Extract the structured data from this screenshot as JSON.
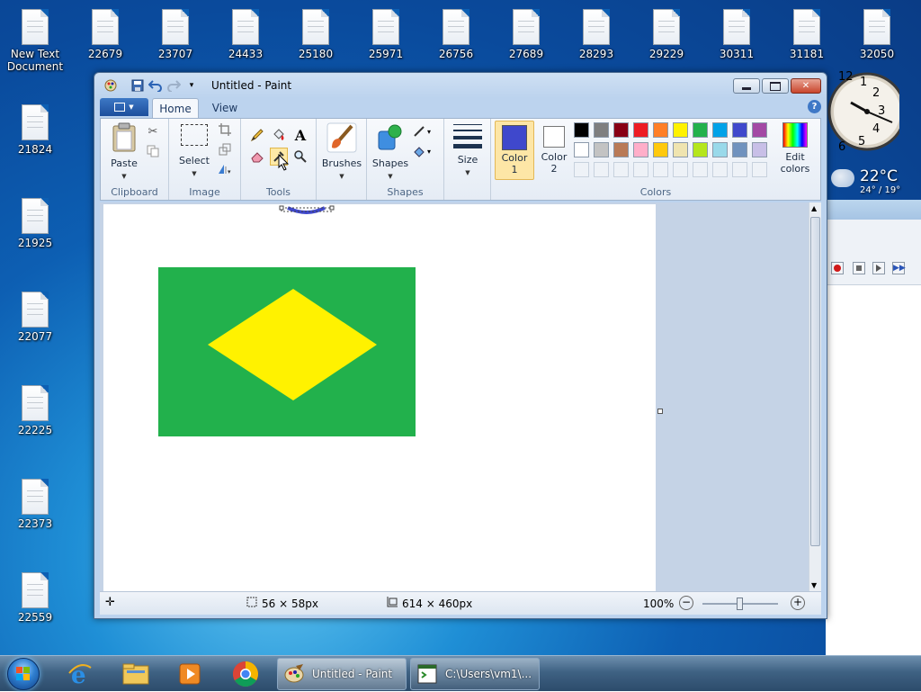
{
  "desktop": {
    "icons": [
      {
        "label": "New Text Document"
      },
      {
        "label": "22679"
      },
      {
        "label": "23707"
      },
      {
        "label": "24433"
      },
      {
        "label": "25180"
      },
      {
        "label": "25971"
      },
      {
        "label": "26756"
      },
      {
        "label": "27689"
      },
      {
        "label": "28293"
      },
      {
        "label": "29229"
      },
      {
        "label": "30311"
      },
      {
        "label": "31181"
      },
      {
        "label": "32050"
      },
      {
        "label": "21824"
      },
      {
        "label": "21925"
      },
      {
        "label": "22077"
      },
      {
        "label": "22225"
      },
      {
        "label": "22373"
      },
      {
        "label": "22559"
      }
    ],
    "clock": {
      "numbers": [
        "12",
        "1",
        "2",
        "3",
        "4",
        "5",
        "6"
      ]
    },
    "weather": {
      "temp": "22°C",
      "range": "24° / 19°"
    }
  },
  "paint": {
    "title": "Untitled - Paint",
    "tabs": {
      "home": "Home",
      "view": "View"
    },
    "help": "?",
    "groups": {
      "clipboard": "Clipboard",
      "image": "Image",
      "tools": "Tools",
      "brushes": "Brushes",
      "shapes": "Shapes",
      "size": "Size",
      "colors": "Colors"
    },
    "buttons": {
      "paste": "Paste",
      "select": "Select",
      "brushes": "Brushes",
      "shapes": "Shapes",
      "size": "Size",
      "color1": "Color 1",
      "color2": "Color 2",
      "edit_colors": "Edit colors"
    },
    "color1": "#3f48cc",
    "color2": "#ffffff",
    "palette_row1": [
      "#000000",
      "#7f7f7f",
      "#880015",
      "#ed1c24",
      "#ff7f27",
      "#fff200",
      "#22b14c",
      "#00a2e8",
      "#3f48cc",
      "#a349a4"
    ],
    "palette_row2": [
      "#ffffff",
      "#c3c3c3",
      "#b97a57",
      "#ffaec9",
      "#ffc90e",
      "#efe4b0",
      "#b5e61d",
      "#99d9ea",
      "#7092be",
      "#c8bfe7"
    ],
    "status": {
      "selection": "56 × 58px",
      "canvas_size": "614 × 460px",
      "zoom": "100%"
    },
    "drawing": {
      "background": "#22b14c",
      "diamond": "#fff200",
      "stroke": "#3f48cc"
    }
  },
  "taskbar": {
    "tasks": [
      {
        "label": "Untitled - Paint"
      },
      {
        "label": "C:\\Users\\vm1\\..."
      }
    ]
  }
}
